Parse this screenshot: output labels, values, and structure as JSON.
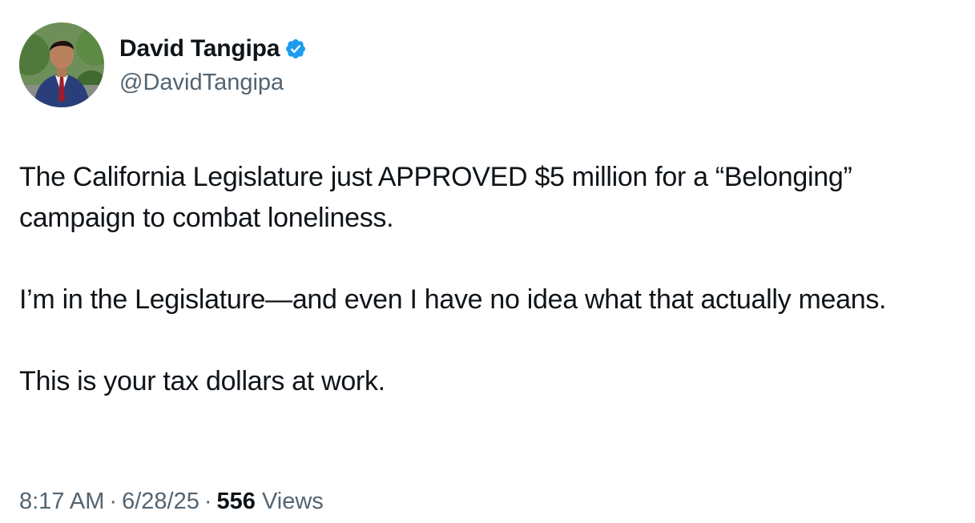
{
  "author": {
    "display_name": "David Tangipa",
    "handle": "@DavidTangipa",
    "verified": true,
    "verified_color": "#1d9bf0"
  },
  "tweet": {
    "paragraphs": [
      "The California Legislature just APPROVED $5 million for a “Belonging” campaign to combat loneliness.",
      "I’m in the Legislature—and even I have no idea what that actually means.",
      "This is your tax dollars at work."
    ]
  },
  "meta": {
    "time": "8:17 AM",
    "separator": "·",
    "date": "6/28/25",
    "views_count": "556",
    "views_label": "Views"
  }
}
